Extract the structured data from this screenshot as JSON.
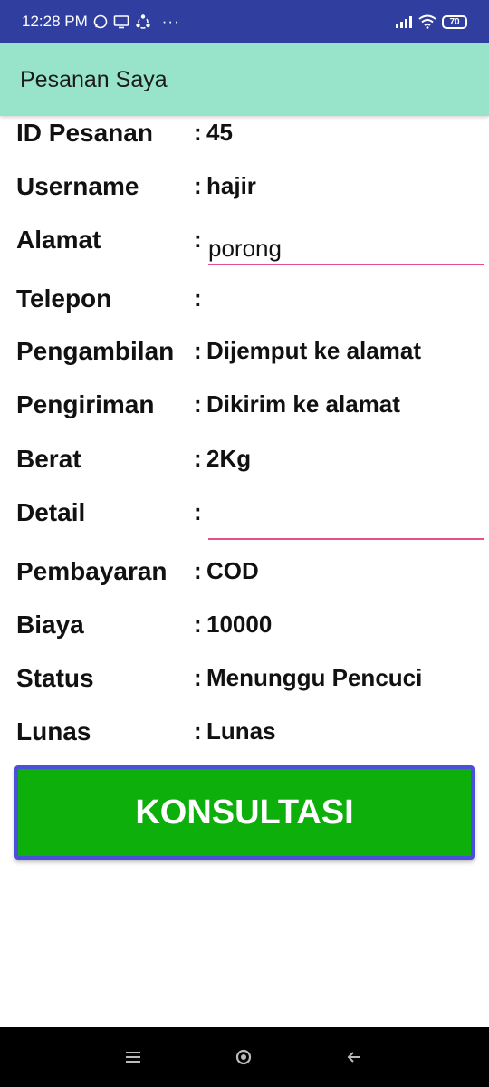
{
  "status_bar": {
    "time": "12:28 PM",
    "notification_icons": [
      "whatsapp-icon",
      "cast-icon",
      "sync-icon",
      "more-dots-icon"
    ],
    "more": "···",
    "battery": "70"
  },
  "app_bar": {
    "title": "Pesanan Saya"
  },
  "fields": {
    "id_pesanan": {
      "label": "ID Pesanan",
      "value": "45"
    },
    "username": {
      "label": "Username",
      "value": "hajir"
    },
    "alamat": {
      "label": "Alamat",
      "value": "porong"
    },
    "telepon": {
      "label": "Telepon",
      "value": ""
    },
    "pengambilan": {
      "label": "Pengambilan",
      "value": "Dijemput ke alamat"
    },
    "pengiriman": {
      "label": "Pengiriman",
      "value": "Dikirim ke alamat"
    },
    "berat": {
      "label": "Berat",
      "value": "2Kg"
    },
    "detail": {
      "label": "Detail",
      "value": ""
    },
    "pembayaran": {
      "label": "Pembayaran",
      "value": "COD"
    },
    "biaya": {
      "label": "Biaya",
      "value": "10000"
    },
    "status": {
      "label": "Status",
      "value": "Menunggu Pencuci"
    },
    "lunas": {
      "label": "Lunas",
      "value": "Lunas"
    }
  },
  "separator": ":",
  "button": {
    "label": "KONSULTASI"
  },
  "colors": {
    "status_bar": "#303f9f",
    "app_bar": "#98e4ca",
    "button": "#0daf0b",
    "button_border": "#4a50d8",
    "input_underline": "#e84e8a"
  },
  "nav_bar": {
    "items": [
      "menu-icon",
      "home-icon",
      "back-icon"
    ]
  }
}
